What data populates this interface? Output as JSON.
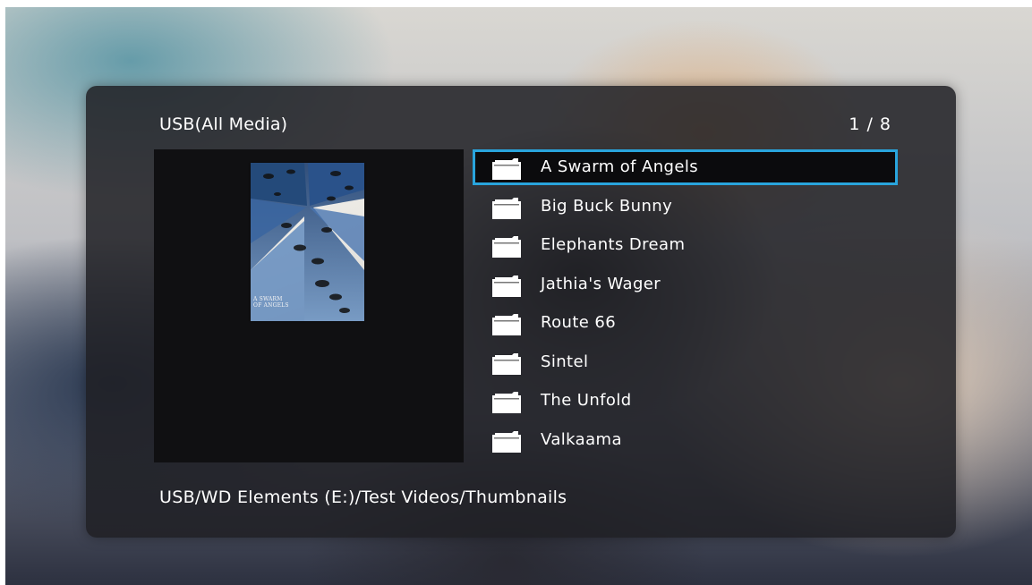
{
  "header": {
    "title": "USB(All Media)",
    "page_counter": "1 / 8"
  },
  "preview": {
    "thumbnail_caption_line1": "A SWARM",
    "thumbnail_caption_line2": "OF ANGELS"
  },
  "list": {
    "selected_index": 0,
    "items": [
      {
        "label": "A Swarm of Angels",
        "icon": "folder-icon"
      },
      {
        "label": "Big Buck Bunny",
        "icon": "folder-icon"
      },
      {
        "label": "Elephants Dream",
        "icon": "folder-icon"
      },
      {
        "label": "Jathia's Wager",
        "icon": "folder-icon"
      },
      {
        "label": "Route 66",
        "icon": "folder-icon"
      },
      {
        "label": "Sintel",
        "icon": "folder-icon"
      },
      {
        "label": "The Unfold",
        "icon": "folder-icon"
      },
      {
        "label": "Valkaama",
        "icon": "folder-icon"
      }
    ]
  },
  "footer": {
    "path": "USB/WD Elements (E:)/Test Videos/Thumbnails"
  },
  "colors": {
    "selection_border": "#29a4dc",
    "panel_background": "#202024",
    "text": "#ffffff"
  }
}
